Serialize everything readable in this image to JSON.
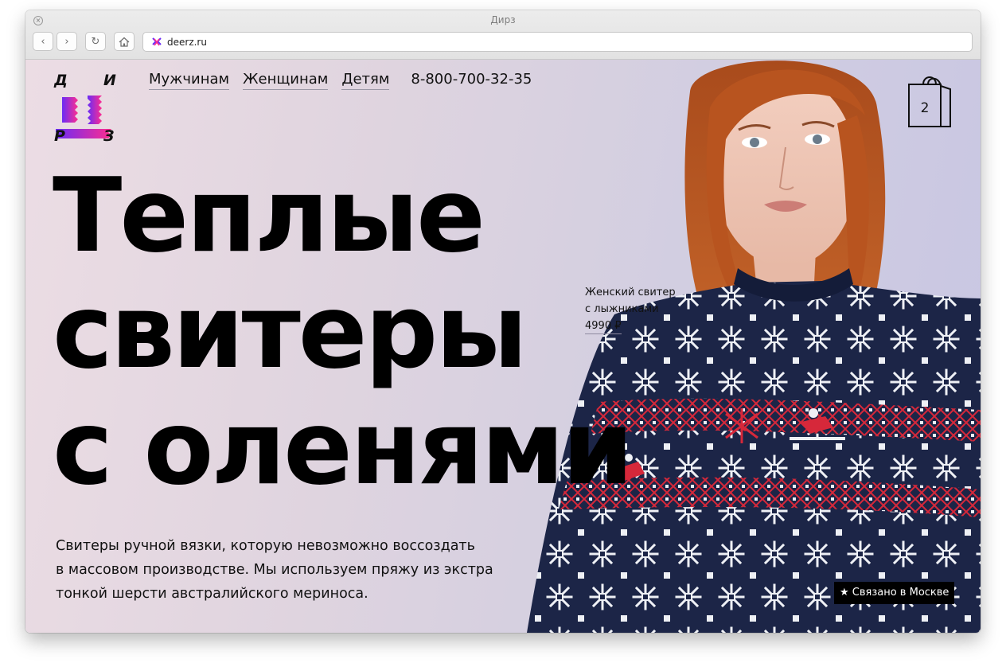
{
  "browser": {
    "window_title": "Дирз",
    "url": "deerz.ru",
    "close_glyph": "×",
    "back_glyph": "‹",
    "forward_glyph": "›",
    "reload_glyph": "↻"
  },
  "logo": {
    "letters": [
      "Д",
      "И",
      "Р",
      "З"
    ],
    "colors": [
      "#6a2cf6",
      "#ff2d8f"
    ]
  },
  "nav": {
    "items": [
      "Мужчинам",
      "Женщинам",
      "Детям"
    ],
    "phone": "8-800-700-32-35"
  },
  "cart": {
    "count": "2"
  },
  "hero": {
    "headline_lines": [
      "Теплые",
      "свитеры",
      "с оленями"
    ],
    "product_name_lines": [
      "Женский свитер",
      "с лыжниками"
    ],
    "product_price": "4990 ₽",
    "description_lines": [
      "Свитеры ручной вязки, которую невозможно воссоздать",
      "в массовом производстве. Мы используем пряжу из экстра",
      "тонкой шерсти австралийского мериноса."
    ],
    "badge": "★ Связано в Москве"
  },
  "colors": {
    "sweater_navy": "#1c2547",
    "sweater_red": "#d6283a",
    "hair": "#b8541f"
  }
}
